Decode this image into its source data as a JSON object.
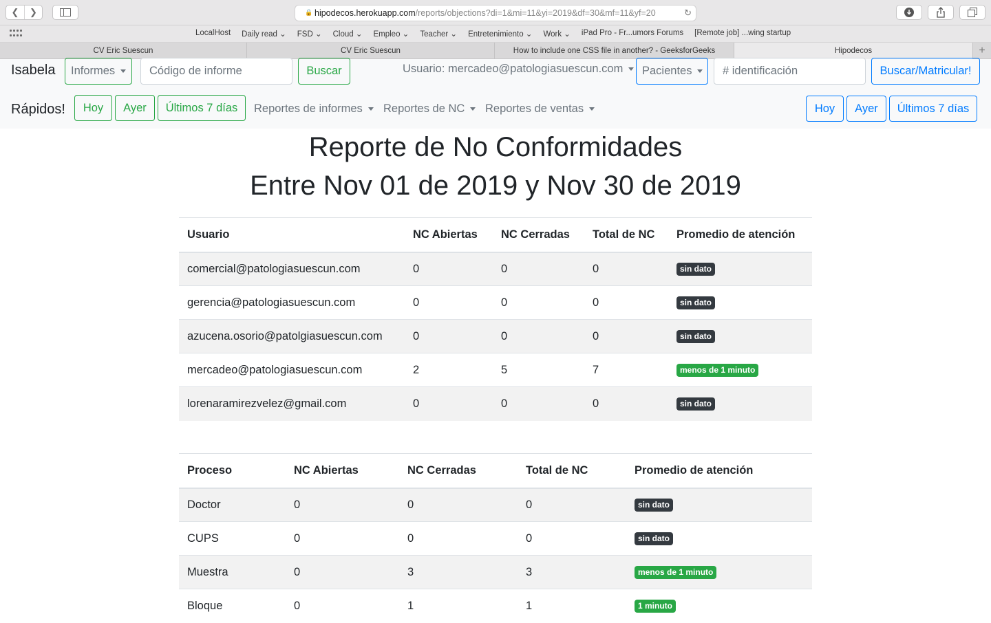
{
  "browser": {
    "url_domain": "hipodecos.herokuapp.com",
    "url_path": "/reports/objections?di=1&mi=11&yi=2019&df=30&mf=11&yf=20",
    "bookmarks": [
      "LocalHost",
      "Daily read ⌄",
      "FSD ⌄",
      "Cloud ⌄",
      "Empleo ⌄",
      "Teacher ⌄",
      "Entretenimiento ⌄",
      "Work ⌄",
      "iPad Pro - Fr...umors Forums",
      "[Remote job] ...wing startup"
    ],
    "tabs": [
      "CV Eric Suescun",
      "CV Eric Suescun",
      "How to include one CSS file in another? - GeeksforGeeks",
      "Hipodecos"
    ]
  },
  "nav": {
    "brand": "Isabela",
    "informes": "Informes",
    "codigo_placeholder": "Código de informe",
    "buscar": "Buscar",
    "usuario": "Usuario: mercadeo@patologiasuescun.com",
    "pacientes": "Pacientes",
    "identificacion_placeholder": "# identificación",
    "buscar_matricular": "Buscar/Matricular!",
    "rapidos": "Rápidos!",
    "hoy": "Hoy",
    "ayer": "Ayer",
    "ultimos": "Últimos 7 días",
    "reportes_informes": "Reportes de informes",
    "reportes_nc": "Reportes de NC",
    "reportes_ventas": "Reportes de ventas"
  },
  "report": {
    "title": "Reporte de No Conformidades",
    "subtitle": "Entre Nov 01 de 2019 y Nov 30 de 2019"
  },
  "users_table": {
    "headers": [
      "Usuario",
      "NC Abiertas",
      "NC Cerradas",
      "Total de NC",
      "Promedio de atención"
    ],
    "rows": [
      [
        "comercial@patologiasuescun.com",
        "0",
        "0",
        "0",
        "sin dato"
      ],
      [
        "gerencia@patologiasuescun.com",
        "0",
        "0",
        "0",
        "sin dato"
      ],
      [
        "azucena.osorio@patolgiasuescun.com",
        "0",
        "0",
        "0",
        "sin dato"
      ],
      [
        "mercadeo@patologiasuescun.com",
        "2",
        "5",
        "7",
        "menos de 1 minuto"
      ],
      [
        "lorenaramirezvelez@gmail.com",
        "0",
        "0",
        "0",
        "sin dato"
      ]
    ]
  },
  "process_table": {
    "headers": [
      "Proceso",
      "NC Abiertas",
      "NC Cerradas",
      "Total de NC",
      "Promedio de atención"
    ],
    "rows": [
      [
        "Doctor",
        "0",
        "0",
        "0",
        "sin dato"
      ],
      [
        "CUPS",
        "0",
        "0",
        "0",
        "sin dato"
      ],
      [
        "Muestra",
        "0",
        "3",
        "3",
        "menos de 1 minuto"
      ],
      [
        "Bloque",
        "0",
        "1",
        "1",
        "1 minuto"
      ]
    ]
  },
  "colors": {
    "success": "#28a745",
    "primary": "#007bff",
    "dark_badge": "#343a40"
  }
}
